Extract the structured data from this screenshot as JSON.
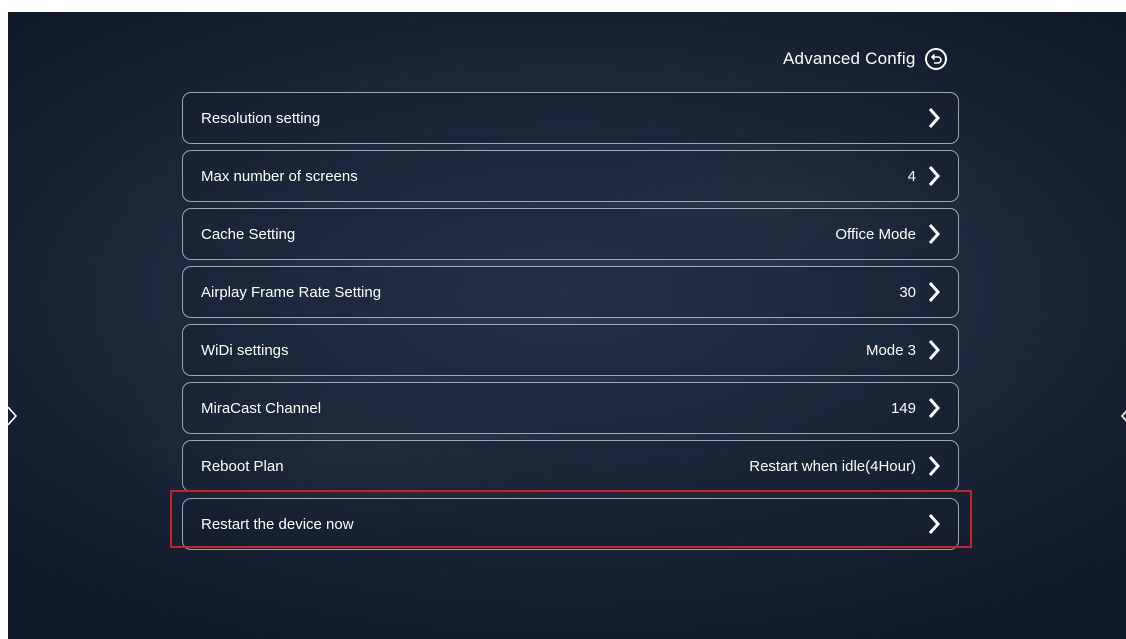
{
  "header": {
    "title": "Advanced Config",
    "back_icon": "back-arrow-circle-icon"
  },
  "settings": [
    {
      "label": "Resolution setting",
      "value": ""
    },
    {
      "label": "Max number of screens",
      "value": "4"
    },
    {
      "label": "Cache Setting",
      "value": "Office Mode"
    },
    {
      "label": "Airplay Frame Rate Setting",
      "value": "30"
    },
    {
      "label": "WiDi settings",
      "value": "Mode 3"
    },
    {
      "label": "MiraCast Channel",
      "value": "149"
    },
    {
      "label": "Reboot Plan",
      "value": "Restart when idle(4Hour)"
    },
    {
      "label": "Restart the device now",
      "value": ""
    }
  ],
  "highlighted_item": "Restart the device now",
  "colors": {
    "highlight_border": "#c8232c",
    "row_border": "#c8d2e1",
    "text": "#ffffff"
  },
  "icons": {
    "row_chevron": "chevron-right-icon",
    "left_nav": "chevron-left-edge-icon",
    "right_nav": "chevron-right-edge-icon"
  }
}
